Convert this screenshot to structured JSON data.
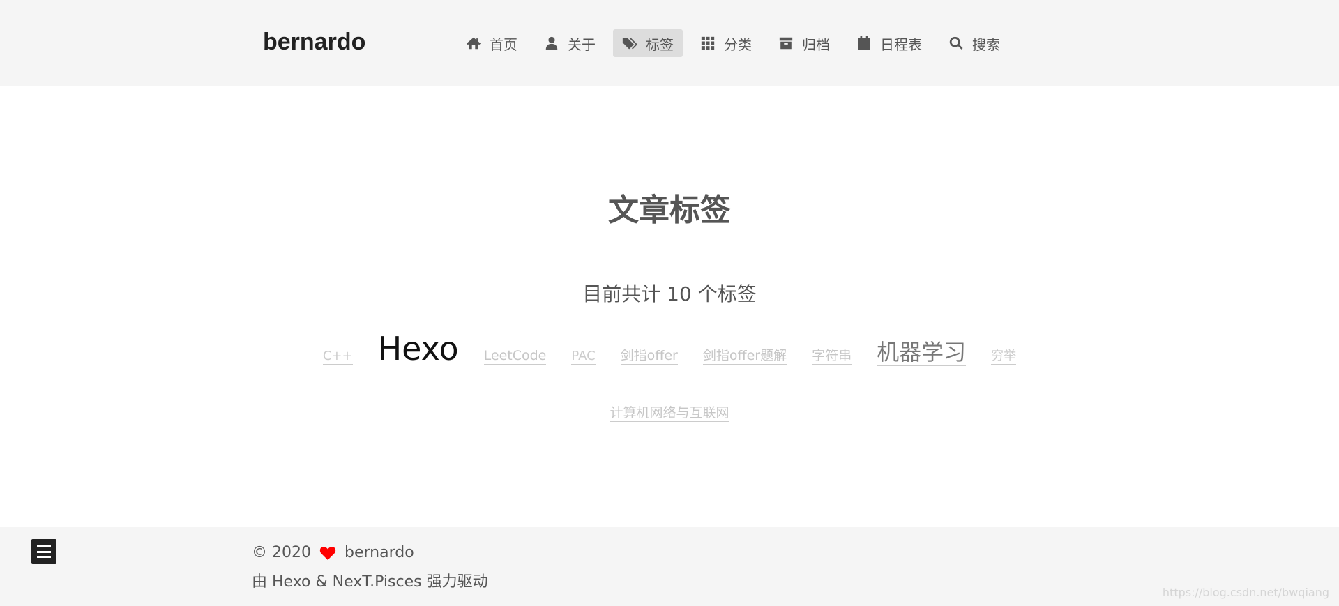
{
  "site": {
    "brand": "bernardo"
  },
  "menu": [
    {
      "label": "首页",
      "icon": "home-icon",
      "active": false
    },
    {
      "label": "关于",
      "icon": "user-icon",
      "active": false
    },
    {
      "label": "标签",
      "icon": "tags-icon",
      "active": true
    },
    {
      "label": "分类",
      "icon": "grid-icon",
      "active": false
    },
    {
      "label": "归档",
      "icon": "archive-icon",
      "active": false
    },
    {
      "label": "日程表",
      "icon": "calendar-icon",
      "active": false
    },
    {
      "label": "搜索",
      "icon": "search-icon",
      "active": false
    }
  ],
  "main": {
    "title": "文章标签",
    "count_text": "目前共计 10 个标签"
  },
  "tags": [
    {
      "name": "C++",
      "size": 18,
      "color": "#cccccc"
    },
    {
      "name": "Hexo",
      "size": 46,
      "color": "#111111"
    },
    {
      "name": "LeetCode",
      "size": 19,
      "color": "#c6c6c6"
    },
    {
      "name": "PAC",
      "size": 18,
      "color": "#cccccc"
    },
    {
      "name": "剑指offer",
      "size": 19,
      "color": "#c6c6c6"
    },
    {
      "name": "剑指offer题解",
      "size": 19,
      "color": "#c6c6c6"
    },
    {
      "name": "字符串",
      "size": 19,
      "color": "#c6c6c6"
    },
    {
      "name": "机器学习",
      "size": 32,
      "color": "#777777"
    },
    {
      "name": "穷举",
      "size": 18,
      "color": "#cccccc"
    },
    {
      "name": "计算机网络与互联网",
      "size": 19,
      "color": "#c6c6c6"
    }
  ],
  "footer": {
    "copyright_prefix": "© 2020",
    "author": "bernardo",
    "powered_prefix": "由",
    "hexo_link": "Hexo",
    "amp": "&",
    "theme_link": "NexT.Pisces",
    "powered_suffix": "强力驱动"
  },
  "watermark": "https://blog.csdn.net/bwqiang",
  "colors": {
    "heart": "#ff0000",
    "active_menu_bg": "#dddddd",
    "header_bg": "#f5f5f5"
  }
}
